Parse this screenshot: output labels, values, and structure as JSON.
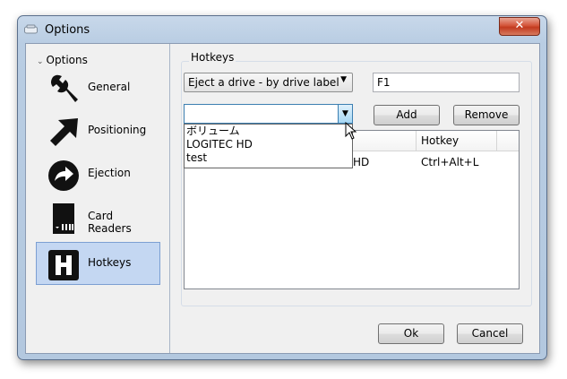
{
  "window": {
    "title": "Options",
    "close_glyph": "✕"
  },
  "nav": {
    "header": "Options",
    "items": [
      {
        "id": "general",
        "label": "General",
        "icon": "wrench-icon"
      },
      {
        "id": "positioning",
        "label": "Positioning",
        "icon": "arrow-up-right-icon"
      },
      {
        "id": "ejection",
        "label": "Ejection",
        "icon": "eject-arrow-icon"
      },
      {
        "id": "card-readers",
        "label": "Card Readers",
        "icon": "sd-card-icon"
      },
      {
        "id": "hotkeys",
        "label": "Hotkeys",
        "icon": "hotkey-h-icon",
        "selected": true
      }
    ]
  },
  "hotkeys": {
    "group_title": "Hotkeys",
    "action_select": "Eject a drive - by drive label",
    "hotkey_field": "F1",
    "drive_combo_value": "",
    "drive_options": [
      "ボリューム",
      "LOGITEC HD",
      "test"
    ],
    "add_button": "Add",
    "remove_button": "Remove",
    "table": {
      "columns": [
        "",
        "Hotkey"
      ],
      "rows": [
        {
          "label_suffix": "HD",
          "hotkey": "Ctrl+Alt+L"
        }
      ]
    }
  },
  "footer": {
    "ok": "Ok",
    "cancel": "Cancel"
  },
  "colors": {
    "selection_bg": "#c4d7f2",
    "title_bg": "#b9cde3",
    "close_red": "#c23a1f"
  }
}
